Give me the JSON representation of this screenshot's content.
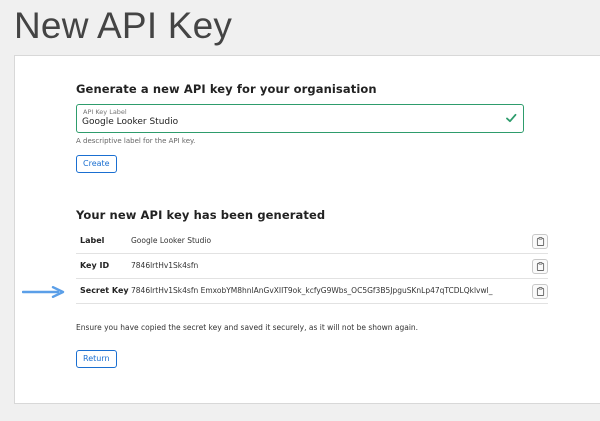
{
  "page": {
    "title": "New API Key"
  },
  "generate_section": {
    "heading": "Generate a new API key for your organisation",
    "label_field": {
      "floating_label": "API Key Label",
      "value": "Google Looker Studio",
      "help_text": "A descriptive label for the API key.",
      "valid_icon": "check-icon"
    },
    "create_button": "Create"
  },
  "result_section": {
    "heading": "Your new API key has been generated",
    "rows": [
      {
        "key": "Label",
        "value": "Google Looker Studio",
        "copy_icon": "clipboard-icon"
      },
      {
        "key": "Key ID",
        "value": "7846lrtHv1Sk4sfn",
        "copy_icon": "clipboard-icon"
      },
      {
        "key": "Secret Key",
        "value": "7846lrtHv1Sk4sfn EmxobYM8hnlAnGvXIIT9ok_kcfyG9Wbs_OC5Gf3B5JpguSKnLp47qTCDLQklvwl_",
        "copy_icon": "clipboard-icon"
      }
    ],
    "warning": "Ensure you have copied the secret key and saved it securely, as it will not be shown again.",
    "return_button": "Return"
  },
  "annotation": {
    "arrow_icon": "arrow-right-icon",
    "color": "#5b9fe8"
  },
  "colors": {
    "accent": "#1a6fd1",
    "valid_border": "#2e9c6c"
  }
}
